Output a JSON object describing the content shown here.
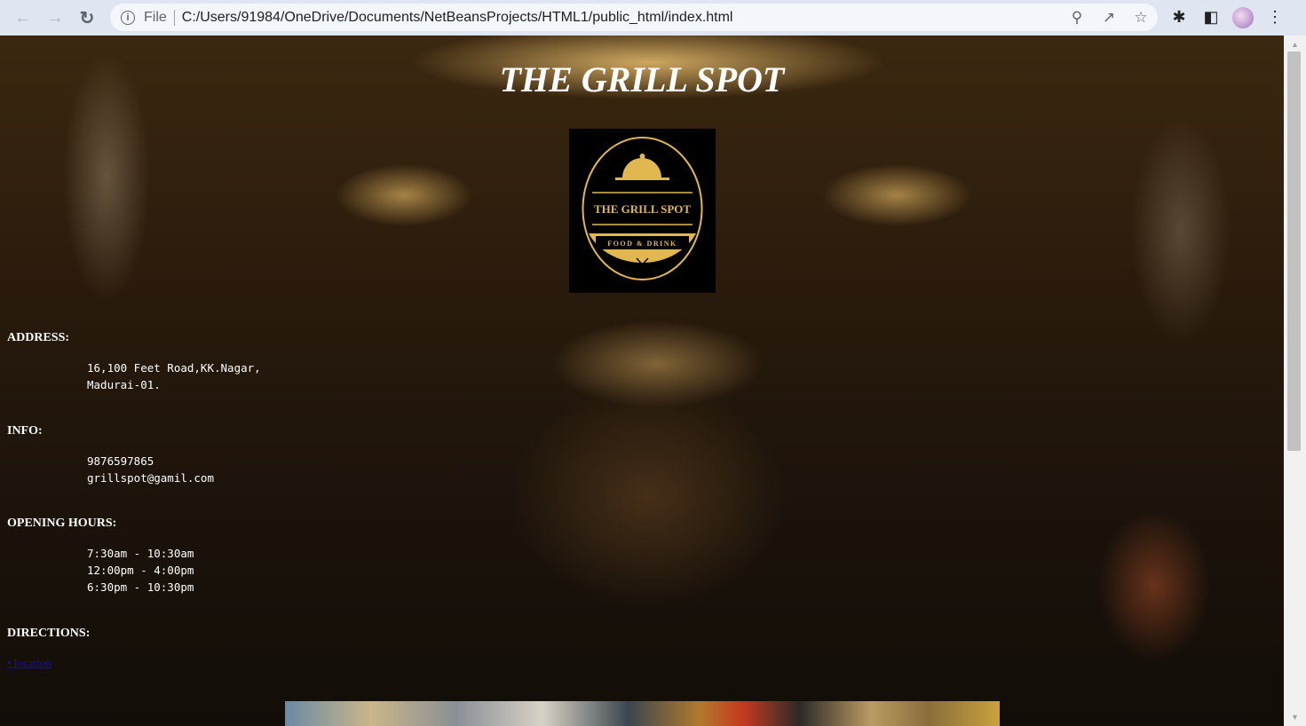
{
  "browser": {
    "scheme_label": "File",
    "url": "C:/Users/91984/OneDrive/Documents/NetBeansProjects/HTML1/public_html/index.html",
    "icons": [
      "back-arrow-icon",
      "forward-arrow-icon",
      "reload-icon",
      "info-icon",
      "zoom-icon",
      "share-icon",
      "bookmark-star-icon",
      "extensions-puzzle-icon",
      "side-panel-icon",
      "profile-avatar",
      "menu-kebab-icon"
    ]
  },
  "page": {
    "title": "THE GRILL SPOT",
    "logo": {
      "name": "THE GRILL SPOT",
      "tagline": "FOOD & DRINK",
      "colors": {
        "gold": "#e0b84f",
        "background": "#000000"
      }
    },
    "address": {
      "heading": "ADDRESS:",
      "lines": [
        "16,100 Feet Road,KK.Nagar,",
        "Madurai-01."
      ]
    },
    "info": {
      "heading": "INFO:",
      "lines": [
        "9876597865",
        "grillspot@gamil.com"
      ]
    },
    "hours": {
      "heading": "OPENING HOURS:",
      "lines": [
        "7:30am - 10:30am",
        "12:00pm - 4:00pm",
        "6:30pm - 10:30pm"
      ]
    },
    "directions": {
      "heading": "DIRECTIONS:",
      "link_text": "• location"
    }
  }
}
